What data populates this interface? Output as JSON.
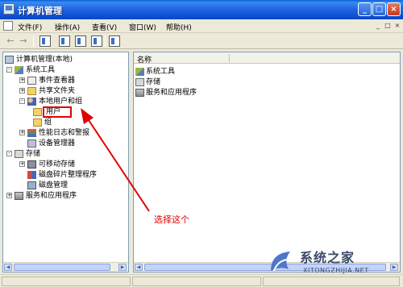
{
  "window": {
    "title": "计算机管理"
  },
  "menubar": {
    "items": [
      "文件(F)",
      "操作(A)",
      "查看(V)",
      "窗口(W)",
      "帮助(H)"
    ],
    "mdi_buttons": [
      "_",
      "□",
      "×"
    ]
  },
  "toolbar": {
    "back": "←",
    "forward": "→"
  },
  "tree": {
    "root": "计算机管理(本地)",
    "nodes": [
      {
        "label": "系统工具",
        "icon": "tools-icon",
        "expander": "-"
      },
      {
        "label": "事件查看器",
        "icon": "event-viewer-icon",
        "expander": "+"
      },
      {
        "label": "共享文件夹",
        "icon": "shared-folder-icon",
        "expander": "+"
      },
      {
        "label": "本地用户和组",
        "icon": "users-icon",
        "expander": "-"
      },
      {
        "label": "用户",
        "icon": "folder-icon",
        "selected": true
      },
      {
        "label": "组",
        "icon": "folder-icon"
      },
      {
        "label": "性能日志和警报",
        "icon": "performance-icon",
        "expander": "+"
      },
      {
        "label": "设备管理器",
        "icon": "device-manager-icon"
      },
      {
        "label": "存储",
        "icon": "storage-icon",
        "expander": "-"
      },
      {
        "label": "可移动存储",
        "icon": "removable-storage-icon",
        "expander": "+"
      },
      {
        "label": "磁盘碎片整理程序",
        "icon": "defrag-icon"
      },
      {
        "label": "磁盘管理",
        "icon": "disk-management-icon"
      },
      {
        "label": "服务和应用程序",
        "icon": "services-icon",
        "expander": "+"
      }
    ]
  },
  "list": {
    "column_header": "名称",
    "items": [
      {
        "label": "系统工具",
        "icon": "tools-icon"
      },
      {
        "label": "存储",
        "icon": "storage-icon"
      },
      {
        "label": "服务和应用程序",
        "icon": "services-icon"
      }
    ]
  },
  "annotation": {
    "text": "选择这个",
    "color": "#e00000"
  },
  "watermark": {
    "brand": "系统之家",
    "url": "XITONGZHIJIA.NET"
  }
}
